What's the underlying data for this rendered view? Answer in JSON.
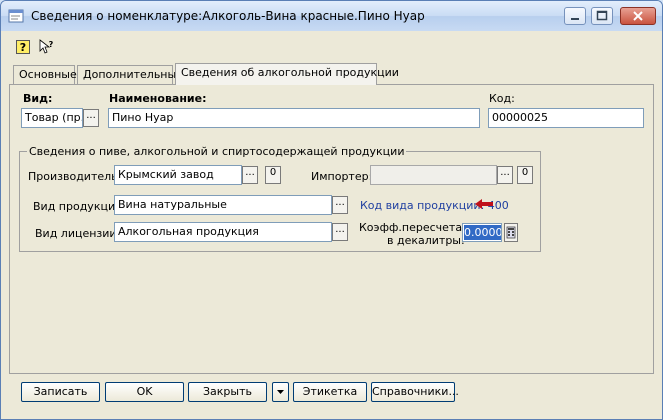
{
  "window": {
    "title": "Сведения о номенклатуре:Алкоголь-Вина красные.Пино Нуар"
  },
  "toolbar": {
    "help_icon": "help-icon",
    "pointer_help_icon": "pointer-help-icon"
  },
  "tabs": [
    {
      "label": "Основные"
    },
    {
      "label": "Дополнительные"
    },
    {
      "label": "Сведения об алкогольной продукции"
    }
  ],
  "form": {
    "vid_label": "Вид:",
    "vid_value": "Товар (пр.",
    "name_label": "Наименование:",
    "name_value": "Пино Нуар",
    "code_label": "Код:",
    "code_value": "00000025"
  },
  "group": {
    "title": "Сведения о пиве, алкогольной и спиртосодержащей продукции",
    "producer_label": "Производитель:",
    "producer_value": "Крымский завод",
    "importer_label": "Импортер:",
    "importer_value": "",
    "product_type_label": "Вид продукции:",
    "product_type_value": "Вина натуральные",
    "product_code_text": "Код вида продукции: 400",
    "license_label": "Вид лицензии:",
    "license_value": "Алкогольная продукция",
    "coef_label_1": "Коэфф.пересчета",
    "coef_label_2": "в декалитры:",
    "coef_value": "0.0000",
    "btn_dots": "...",
    "btn_zero": "0"
  },
  "buttons": {
    "save": "Записать",
    "ok": "OK",
    "close": "Закрыть",
    "label": "Этикетка",
    "references": "Справочники..."
  }
}
